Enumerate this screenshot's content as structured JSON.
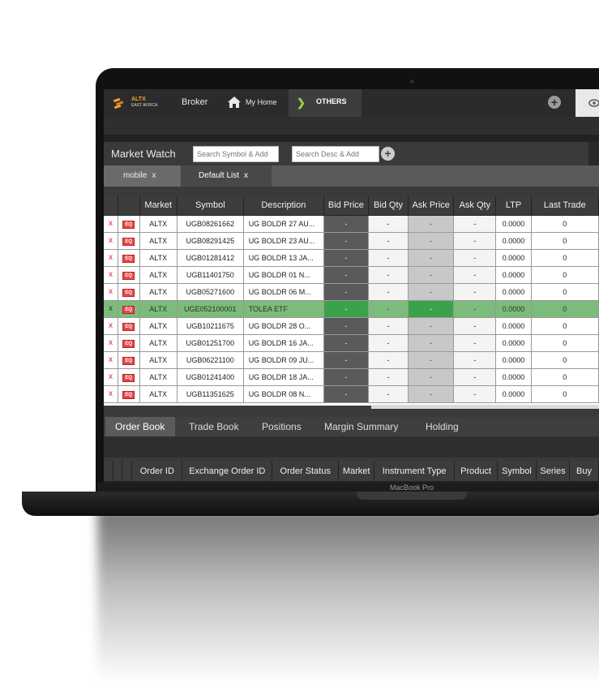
{
  "header": {
    "logo_text": "ALTX",
    "logo_sub": "EAST AFRICA",
    "broker_label": "Broker",
    "home_label": "My Home",
    "others_label": "OTHERS",
    "plus_label": "+"
  },
  "market_watch": {
    "title": "Market Watch",
    "search_symbol_placeholder": "Search Symbol & Add",
    "search_desc_placeholder": "Search Desc & Add",
    "add_label": "+",
    "tabs": [
      {
        "label": "mobile",
        "close": "x"
      },
      {
        "label": "Default List",
        "close": "x"
      }
    ],
    "columns": [
      "",
      "",
      "Market",
      "Symbol",
      "Description",
      "Bid Price",
      "Bid Qty",
      "Ask Price",
      "Ask Qty",
      "LTP",
      "Last Trade"
    ],
    "rows": [
      {
        "remove": "x",
        "type": "EQ",
        "market": "ALTX",
        "symbol": "UGB08261662",
        "desc": "UG BOLDR 27 AU...",
        "bid": "-",
        "bidqty": "-",
        "ask": "-",
        "askqty": "-",
        "ltp": "0.0000",
        "last": "0",
        "highlight": false
      },
      {
        "remove": "x",
        "type": "EQ",
        "market": "ALTX",
        "symbol": "UGB08291425",
        "desc": "UG BOLDR 23 AU...",
        "bid": "-",
        "bidqty": "-",
        "ask": "-",
        "askqty": "-",
        "ltp": "0.0000",
        "last": "0",
        "highlight": false
      },
      {
        "remove": "x",
        "type": "EQ",
        "market": "ALTX",
        "symbol": "UGB01281412",
        "desc": "UG BOLDR 13 JA...",
        "bid": "-",
        "bidqty": "-",
        "ask": "-",
        "askqty": "-",
        "ltp": "0.0000",
        "last": "0",
        "highlight": false
      },
      {
        "remove": "x",
        "type": "EQ",
        "market": "ALTX",
        "symbol": "UGB11401750",
        "desc": "UG BOLDR 01 N...",
        "bid": "-",
        "bidqty": "-",
        "ask": "-",
        "askqty": "-",
        "ltp": "0.0000",
        "last": "0",
        "highlight": false
      },
      {
        "remove": "x",
        "type": "EQ",
        "market": "ALTX",
        "symbol": "UGB05271600",
        "desc": "UG BOLDR 06 M...",
        "bid": "-",
        "bidqty": "-",
        "ask": "-",
        "askqty": "-",
        "ltp": "0.0000",
        "last": "0",
        "highlight": false
      },
      {
        "remove": "x",
        "type": "EQ",
        "market": "ALTX",
        "symbol": "UGE052100001",
        "desc": "TOLEA ETF",
        "bid": "-",
        "bidqty": "-",
        "ask": "-",
        "askqty": "-",
        "ltp": "0.0000",
        "last": "0",
        "highlight": true
      },
      {
        "remove": "x",
        "type": "EQ",
        "market": "ALTX",
        "symbol": "UGB10211675",
        "desc": "UG BOLDR 28 O...",
        "bid": "-",
        "bidqty": "-",
        "ask": "-",
        "askqty": "-",
        "ltp": "0.0000",
        "last": "0",
        "highlight": false
      },
      {
        "remove": "x",
        "type": "EQ",
        "market": "ALTX",
        "symbol": "UGB01251700",
        "desc": "UG BOLDR 16 JA...",
        "bid": "-",
        "bidqty": "-",
        "ask": "-",
        "askqty": "-",
        "ltp": "0.0000",
        "last": "0",
        "highlight": false
      },
      {
        "remove": "x",
        "type": "EQ",
        "market": "ALTX",
        "symbol": "UGB06221100",
        "desc": "UG BOLDR 09 JU...",
        "bid": "-",
        "bidqty": "-",
        "ask": "-",
        "askqty": "-",
        "ltp": "0.0000",
        "last": "0",
        "highlight": false
      },
      {
        "remove": "x",
        "type": "EQ",
        "market": "ALTX",
        "symbol": "UGB01241400",
        "desc": "UG BOLDR 18 JA...",
        "bid": "-",
        "bidqty": "-",
        "ask": "-",
        "askqty": "-",
        "ltp": "0.0000",
        "last": "0",
        "highlight": false
      },
      {
        "remove": "x",
        "type": "EQ",
        "market": "ALTX",
        "symbol": "UGB11351625",
        "desc": "UG BOLDR 08 N...",
        "bid": "-",
        "bidqty": "-",
        "ask": "-",
        "askqty": "-",
        "ltp": "0.0000",
        "last": "0",
        "highlight": false
      }
    ]
  },
  "order_book": {
    "tabs": [
      "Order Book",
      "Trade Book",
      "Positions",
      "Margin Summary",
      "Holding"
    ],
    "active_tab": "Order Book",
    "columns": [
      "",
      "",
      "",
      "Order ID",
      "Exchange Order ID",
      "Order Status",
      "Market",
      "Instrument Type",
      "Product",
      "Symbol",
      "Series",
      "Buy"
    ]
  },
  "device": {
    "label": "MacBook Pro"
  },
  "colors": {
    "accent_logo": "#f2a33a",
    "highlight_row": "#7dbb7b",
    "eq_badge": "#e44a4a",
    "remove_x": "#d9231d",
    "others_chevron": "#9bd04a"
  }
}
